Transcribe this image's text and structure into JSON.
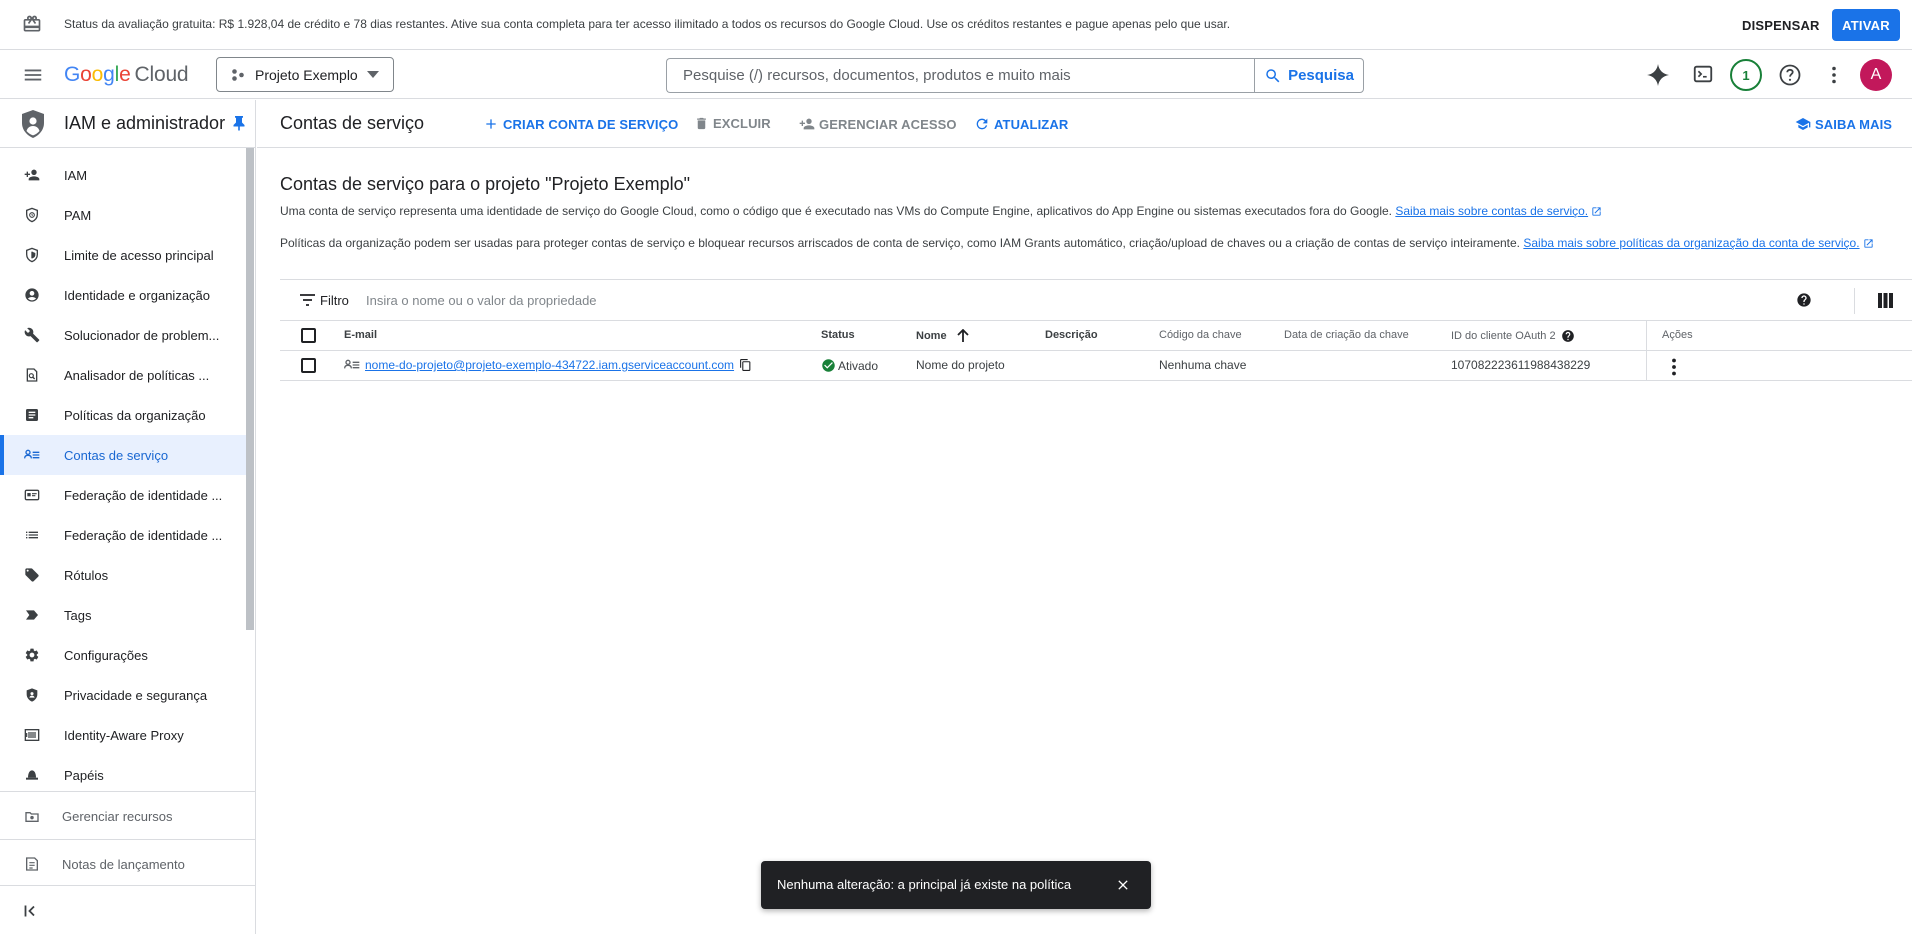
{
  "banner": {
    "text": "Status da avaliação gratuita: R$ 1.928,04 de crédito e 78 dias restantes. Ative sua conta completa para ter acesso ilimitado a todos os recursos do Google Cloud. Use os créditos restantes e pague apenas pelo que usar.",
    "dismiss_label": "DISPENSAR",
    "activate_label": "ATIVAR"
  },
  "header": {
    "logo_google": [
      "G",
      "o",
      "o",
      "g",
      "l",
      "e"
    ],
    "logo_cloud": "Cloud",
    "project_name": "Projeto Exemplo",
    "search_placeholder": "Pesquise (/) recursos, documentos, produtos e muito mais",
    "search_button": "Pesquisa",
    "notification_count": "1",
    "avatar_letter": "A"
  },
  "sidebar": {
    "title": "IAM e administrador",
    "items": [
      {
        "label": "IAM",
        "icon": "person-add-icon"
      },
      {
        "label": "PAM",
        "icon": "shield-clock-icon"
      },
      {
        "label": "Limite de acesso principal",
        "icon": "shield-boundary-icon"
      },
      {
        "label": "Identidade e organização",
        "icon": "account-circle-icon"
      },
      {
        "label": "Solucionador de problem...",
        "icon": "wrench-icon"
      },
      {
        "label": "Analisador de políticas ...",
        "icon": "policy-analyzer-icon"
      },
      {
        "label": "Políticas da organização",
        "icon": "article-icon"
      },
      {
        "label": "Contas de serviço",
        "icon": "service-account-icon",
        "active": true
      },
      {
        "label": "Federação de identidade ...",
        "icon": "badge-icon"
      },
      {
        "label": "Federação de identidade ...",
        "icon": "list-icon"
      },
      {
        "label": "Rótulos",
        "icon": "label-tag-icon"
      },
      {
        "label": "Tags",
        "icon": "tag-arrow-icon"
      },
      {
        "label": "Configurações",
        "icon": "gear-icon"
      },
      {
        "label": "Privacidade e segurança",
        "icon": "privacy-shield-icon"
      },
      {
        "label": "Identity-Aware Proxy",
        "icon": "proxy-icon"
      },
      {
        "label": "Papéis",
        "icon": "roles-hat-icon"
      }
    ],
    "footer": [
      {
        "label": "Gerenciar recursos",
        "icon": "manage-resources-icon"
      },
      {
        "label": "Notas de lançamento",
        "icon": "release-notes-icon"
      }
    ]
  },
  "toolbar": {
    "title": "Contas de serviço",
    "create_label": "CRIAR CONTA DE SERVIÇO",
    "delete_label": "EXCLUIR",
    "manage_access_label": "GERENCIAR ACESSO",
    "refresh_label": "ATUALIZAR",
    "learn_more_label": "SAIBA MAIS"
  },
  "main": {
    "heading": "Contas de serviço para o projeto \"Projeto Exemplo\"",
    "description1": "Uma conta de serviço representa uma identidade de serviço do Google Cloud, como o código que é executado nas VMs do Compute Engine, aplicativos do App Engine ou sistemas executados fora do Google.",
    "description1_link": "Saiba mais sobre contas de serviço.",
    "description2": "Políticas da organização podem ser usadas para proteger contas de serviço e bloquear recursos arriscados de conta de serviço, como IAM Grants automático, criação/upload de chaves ou a criação de contas de serviço inteiramente.",
    "description2_link": "Saiba mais sobre políticas da organização da conta de serviço."
  },
  "filter": {
    "label": "Filtro",
    "placeholder": "Insira o nome ou o valor da propriedade"
  },
  "table": {
    "columns": {
      "email": "E-mail",
      "status": "Status",
      "name": "Nome",
      "description": "Descrição",
      "key_id": "Código da chave",
      "key_created": "Data de criação da chave",
      "oauth_id": "ID do cliente OAuth 2",
      "actions": "Ações"
    },
    "rows": [
      {
        "email": "nome-do-projeto@projeto-exemplo-434722.iam.gserviceaccount.com",
        "status": "Ativado",
        "name": "Nome do projeto",
        "description": "",
        "key_id": "Nenhuma chave",
        "key_created": "",
        "oauth_id": "107082223611988438229"
      }
    ]
  },
  "snackbar": {
    "message": "Nenhuma alteração: a principal já existe na política"
  },
  "colors": {
    "accent": "#1a73e8",
    "active_bg": "#e8f0fe",
    "status_ok": "#188038",
    "avatar": "#c2185b"
  }
}
